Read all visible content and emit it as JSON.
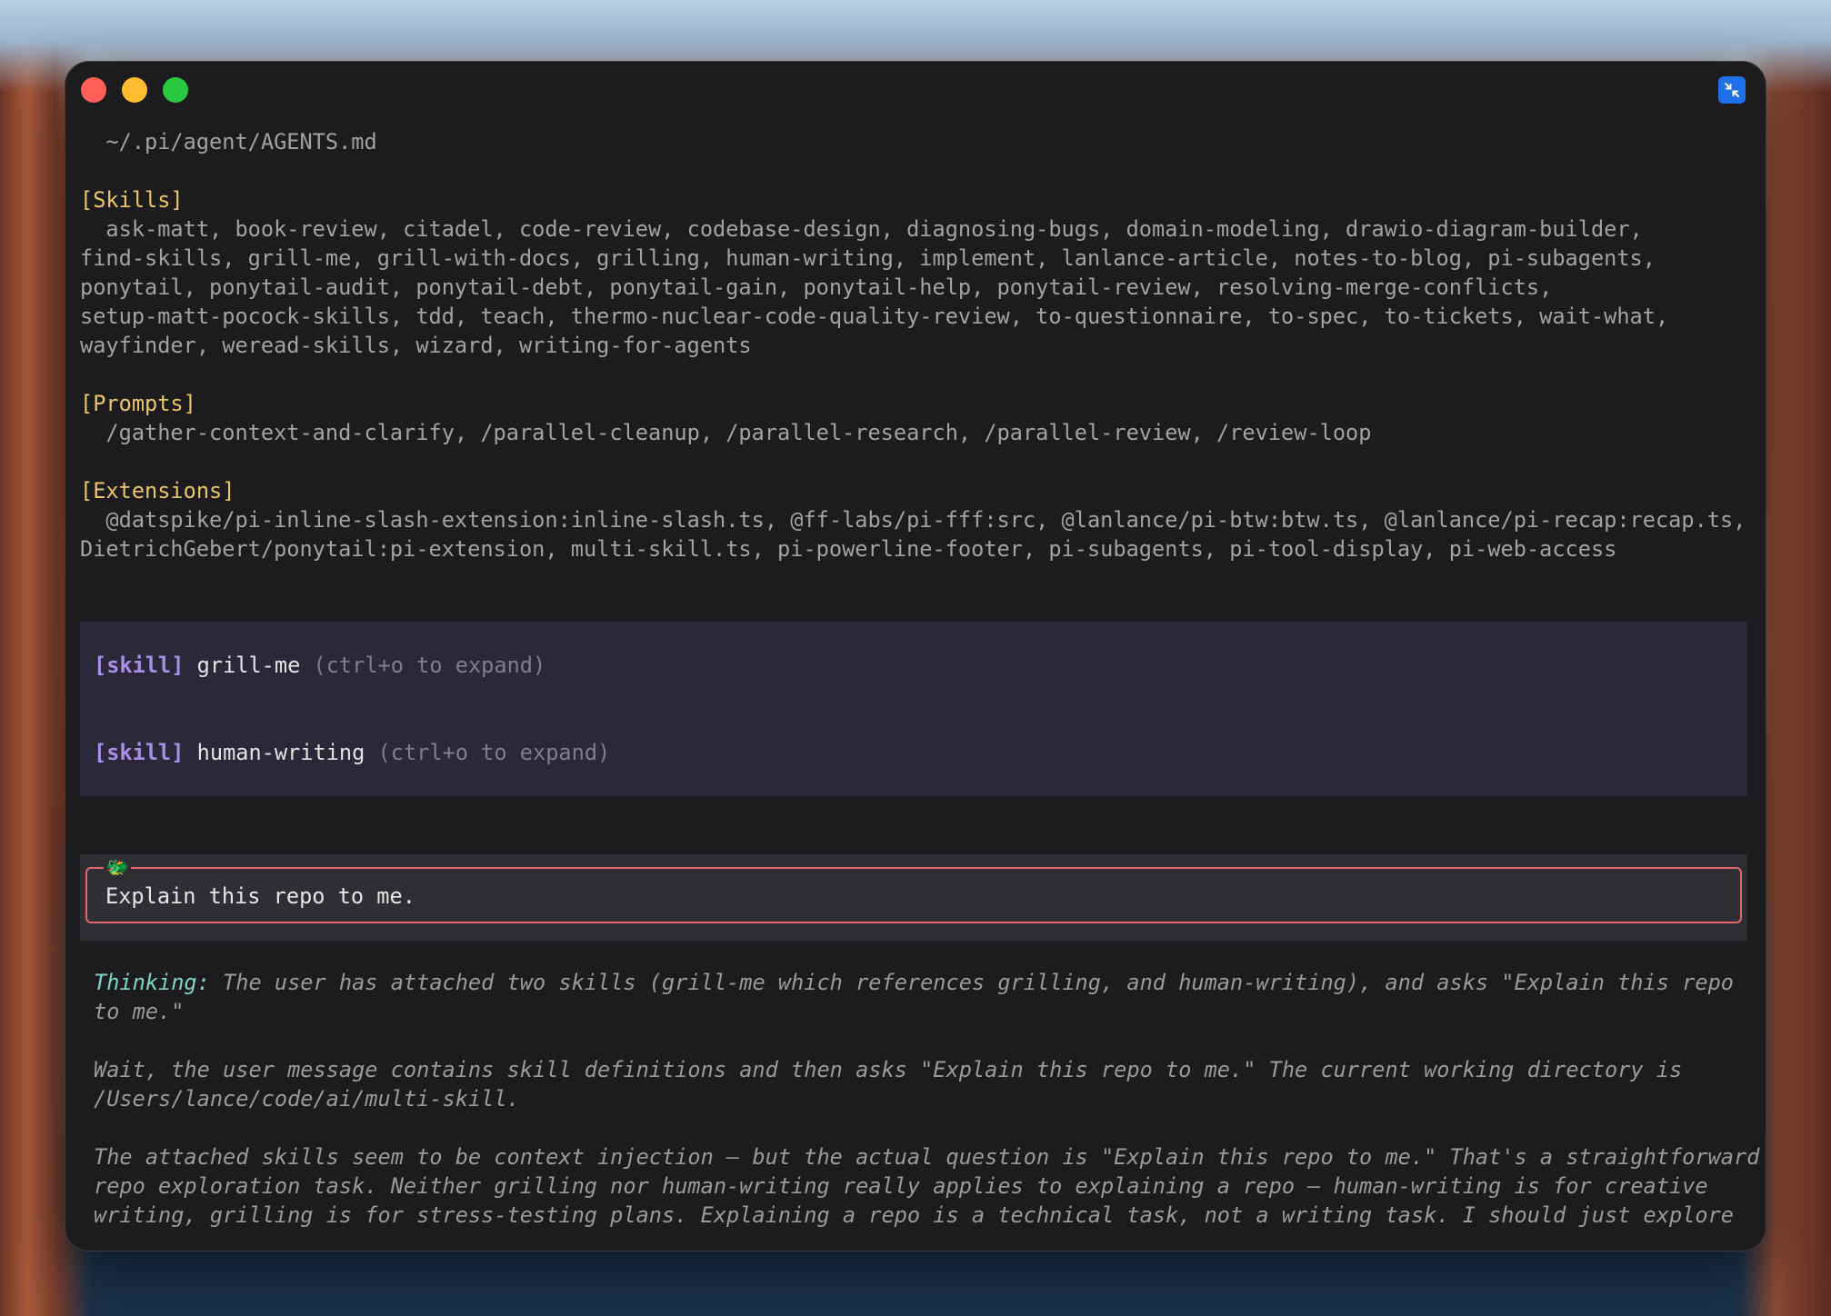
{
  "window": {
    "close_label": "close",
    "minimize_label": "minimize",
    "zoom_label": "zoom"
  },
  "context_file": "  ~/.pi/agent/AGENTS.md",
  "skills": {
    "heading": "[Skills]",
    "lines": [
      "  ask-matt, book-review, citadel, code-review, codebase-design, diagnosing-bugs, domain-modeling, drawio-diagram-builder,",
      "find-skills, grill-me, grill-with-docs, grilling, human-writing, implement, lanlance-article, notes-to-blog, pi-subagents,",
      "ponytail, ponytail-audit, ponytail-debt, ponytail-gain, ponytail-help, ponytail-review, resolving-merge-conflicts,",
      "setup-matt-pocock-skills, tdd, teach, thermo-nuclear-code-quality-review, to-questionnaire, to-spec, to-tickets, wait-what,",
      "wayfinder, weread-skills, wizard, writing-for-agents"
    ]
  },
  "prompts": {
    "heading": "[Prompts]",
    "lines": [
      "  /gather-context-and-clarify, /parallel-cleanup, /parallel-research, /parallel-review, /review-loop"
    ]
  },
  "extensions": {
    "heading": "[Extensions]",
    "lines": [
      "  @datspike/pi-inline-slash-extension:inline-slash.ts, @ff-labs/pi-fff:src, @lanlance/pi-btw:btw.ts, @lanlance/pi-recap:recap.ts,",
      "DietrichGebert/ponytail:pi-extension, multi-skill.ts, pi-powerline-footer, pi-subagents, pi-tool-display, pi-web-access"
    ]
  },
  "attached_skills": [
    {
      "tag": "[skill]",
      "name": "grill-me",
      "hint": "(ctrl+o to expand)"
    },
    {
      "tag": "[skill]",
      "name": "human-writing",
      "hint": "(ctrl+o to expand)"
    }
  ],
  "prompt": {
    "icon": "dragon-icon",
    "text": "Explain this repo to me."
  },
  "thinking": {
    "label": "Thinking:",
    "first_line": " The user has attached two skills (grill-me which references grilling, and human-writing), and asks \"Explain this repo",
    "lines": [
      "to me.\"",
      "",
      "Wait, the user message contains skill definitions and then asks \"Explain this repo to me.\" The current working directory is",
      "/Users/lance/code/ai/multi-skill.",
      "",
      "The attached skills seem to be context injection — but the actual question is \"Explain this repo to me.\" That's a straightforward",
      "repo exploration task. Neither grilling nor human-writing really applies to explaining a repo — human-writing is for creative",
      "writing, grilling is for stress-testing plans. Explaining a repo is a technical task, not a writing task. I should just explore"
    ]
  },
  "colors": {
    "heading": "#e9c46a",
    "skill_tag": "#a88fe6",
    "thinking_label": "#7fd3c7",
    "prompt_border": "#e06a6a",
    "window_bg": "#1c1c1e"
  }
}
